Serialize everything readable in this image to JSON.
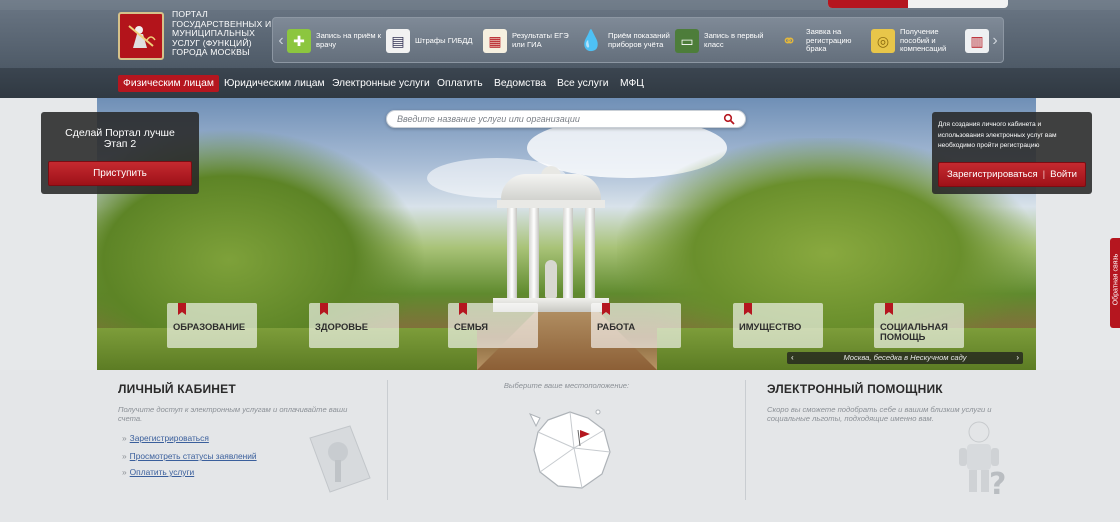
{
  "header": {
    "logo_lines": [
      "ПОРТАЛ",
      "ГОСУДАРСТВЕННЫХ И",
      "МУНИЦИПАЛЬНЫХ",
      "УСЛУГ (ФУНКЦИЙ)",
      "ГОРОДА МОСКВЫ"
    ],
    "quick_links": [
      {
        "label": "Запись на приём к врачу",
        "icon": "medical-cross-icon"
      },
      {
        "label": "Штрафы ГИБДД",
        "icon": "traffic-fine-icon"
      },
      {
        "label": "Результаты ЕГЭ или ГИА",
        "icon": "exam-results-icon"
      },
      {
        "label": "Приём показаний приборов учёта",
        "icon": "water-drop-icon"
      },
      {
        "label": "Запись в первый класс",
        "icon": "school-board-icon"
      },
      {
        "label": "Заявка на регистрацию брака",
        "icon": "wedding-rings-icon"
      },
      {
        "label": "Получение пособий и компенсаций",
        "icon": "coins-icon"
      },
      {
        "label": "",
        "icon": "document-icon"
      }
    ]
  },
  "nav": {
    "items": [
      "Физическим лицам",
      "Юридическим лицам",
      "Электронные услуги",
      "Оплатить",
      "Ведомства",
      "Все услуги",
      "МФЦ"
    ],
    "active_index": 0
  },
  "hero": {
    "search_placeholder": "Введите название услуги или организации",
    "left_panel": {
      "title_line1": "Сделай Портал лучше",
      "title_line2": "Этап 2",
      "button": "Приступить"
    },
    "right_panel": {
      "text": "Для создания личного кабинета и использования электронных услуг вам необходимо пройти регистрацию",
      "register": "Зарегистрироваться",
      "separator": "|",
      "login": "Войти"
    },
    "categories": [
      "ОБРАЗОВАНИЕ",
      "ЗДОРОВЬЕ",
      "СЕМЬЯ",
      "РАБОТА",
      "ИМУЩЕСТВО",
      "СОЦИАЛЬНАЯ ПОМОЩЬ"
    ],
    "caption": "Москва, беседка в Нескучном саду",
    "caption_prev": "‹",
    "caption_next": "›"
  },
  "feedback": "Обратная связь",
  "cabinet": {
    "title": "ЛИЧНЫЙ КАБИНЕТ",
    "text": "Получите доступ к электронным услугам и оплачивайте ваши счета.",
    "links": [
      "Зарегистрироваться",
      "Просмотреть статусы заявлений",
      "Оплатить услуги"
    ]
  },
  "location": {
    "label": "Выберите ваше местоположение:"
  },
  "assistant": {
    "title": "ЭЛЕКТРОННЫЙ ПОМОЩНИК",
    "text": "Скоро вы сможете подобрать себе и вашим близким услуги и социальные льготы, подходящие именно вам."
  },
  "colors": {
    "brand_red": "#b5161f",
    "nav_bg": "#333c46",
    "link": "#3a5f9c"
  }
}
